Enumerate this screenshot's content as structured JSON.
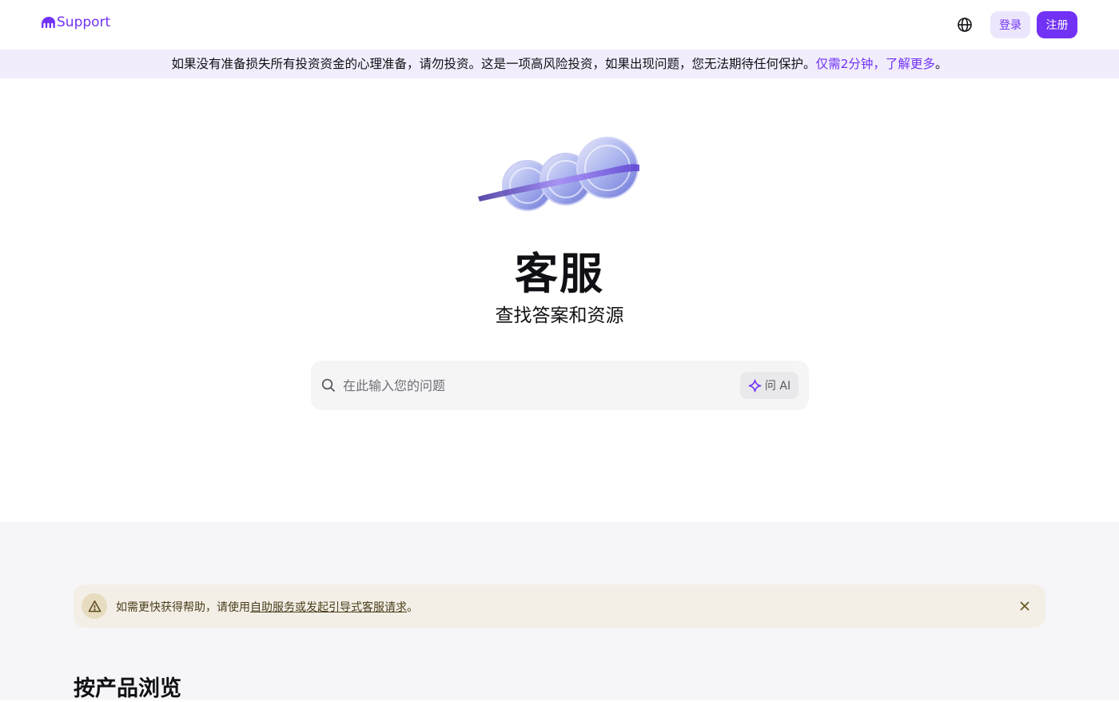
{
  "header": {
    "logo_text": "Support",
    "language_icon": "globe-icon",
    "login_label": "登录",
    "signup_label": "注册"
  },
  "risk_banner": {
    "text": "如果没有准备损失所有投资资金的心理准备，请勿投资。这是一项高风险投资，如果出现问题，您无法期待任何保护。",
    "link_label": "仅需2分钟，了解更多",
    "suffix": "。"
  },
  "hero": {
    "title": "客服",
    "subtitle": "查找答案和资源"
  },
  "search": {
    "placeholder": "在此输入您的问题",
    "ask_ai_label": "问 AI"
  },
  "notice": {
    "prefix": "如需更快获得帮助，请使用",
    "link_label": "自助服务或发起引导式客服请求",
    "suffix": "。"
  },
  "browse": {
    "title": "按产品浏览"
  },
  "colors": {
    "brand": "#7132f5",
    "banner_bg": "#f1edfd",
    "notice_bg": "#f3efe7"
  }
}
